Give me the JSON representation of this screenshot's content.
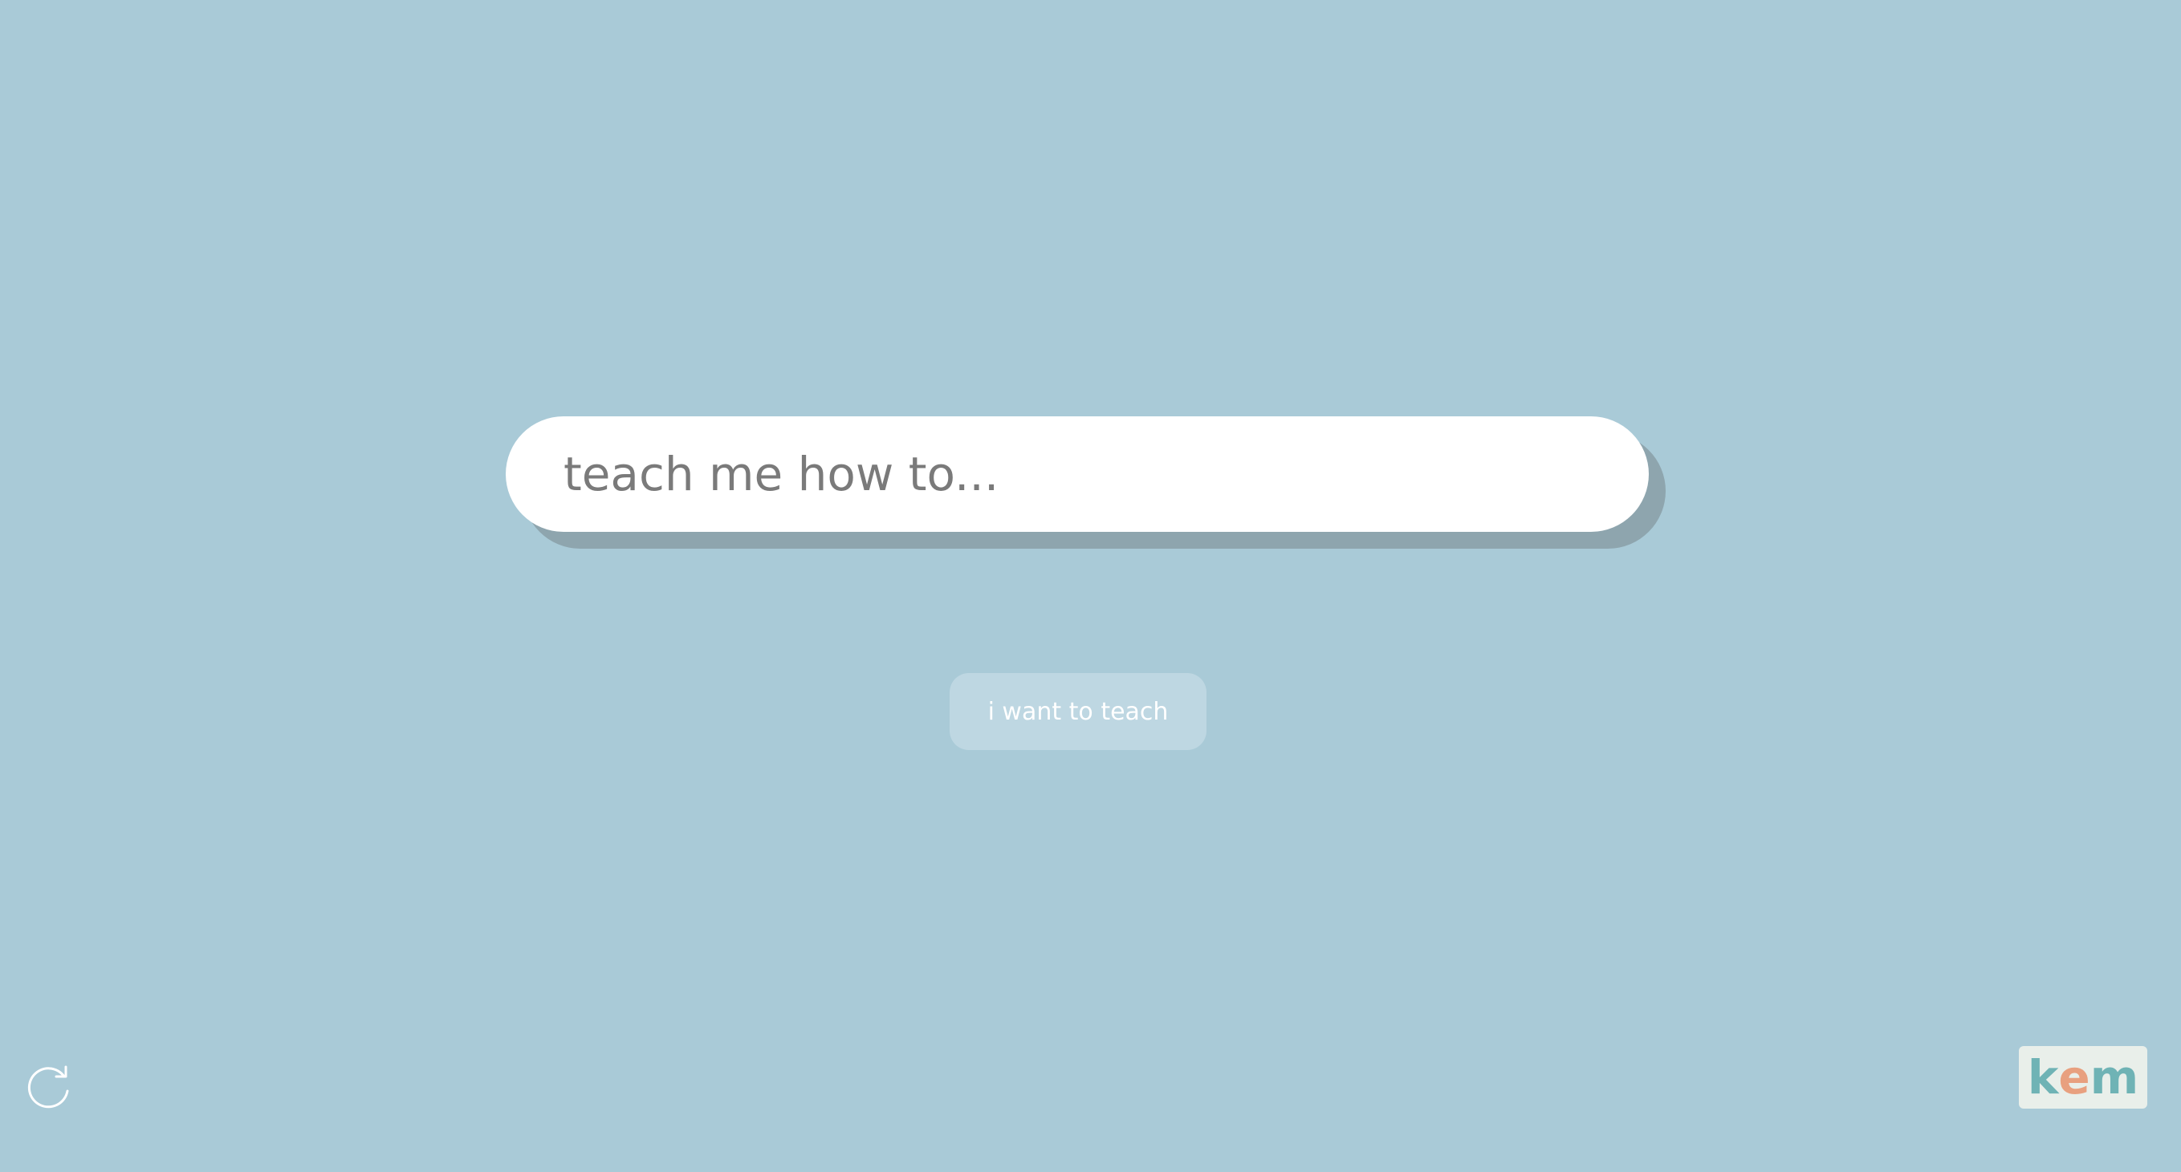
{
  "search": {
    "placeholder": "teach me how to...",
    "value": ""
  },
  "teach_button": {
    "label": "i want to teach"
  },
  "refresh": {
    "icon": "refresh-icon"
  },
  "logo": {
    "letters": [
      "k",
      "e",
      "m"
    ]
  },
  "colors": {
    "background": "#a9cad7",
    "search_bar": "#ffffff",
    "search_shadow": "#8ea5ae",
    "button": "#bed7e2",
    "logo_background": "#e9efea",
    "logo_teal": "#6fb3b5",
    "logo_orange": "#e8a07f"
  }
}
